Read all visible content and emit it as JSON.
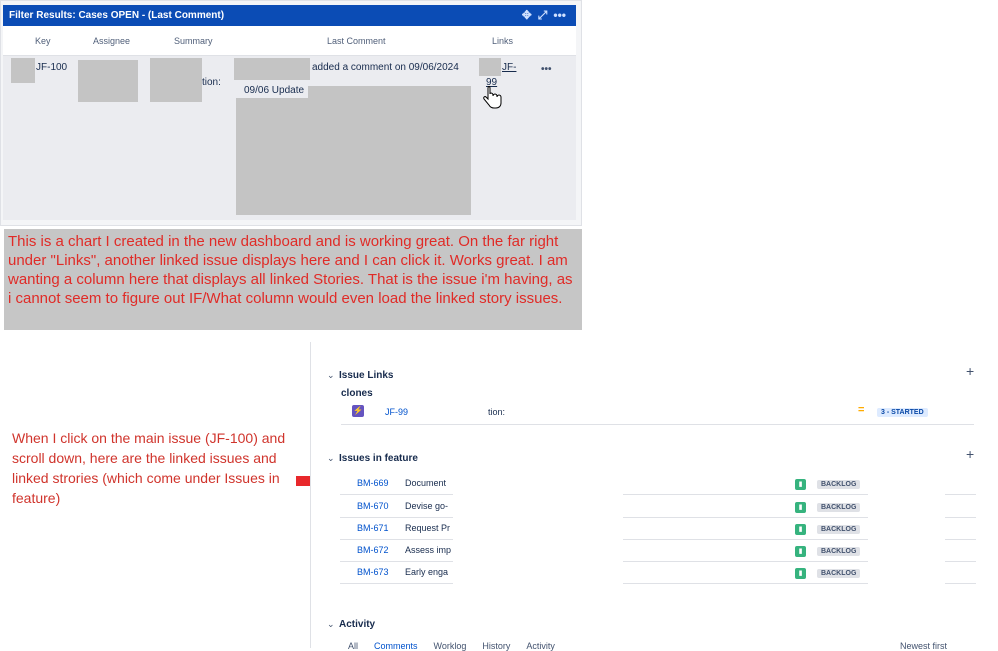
{
  "gadget": {
    "title": "Filter Results: Cases OPEN - (Last Comment)",
    "columns": [
      "Key",
      "Assignee",
      "Summary",
      "Last Comment",
      "Links"
    ],
    "row": {
      "key": "JF-100",
      "summary_fragment": "tion:",
      "comment_line1": "added a comment on 09/06/2024",
      "comment_line2": "09/06 Update",
      "link_key_a": "JF-",
      "link_key_b": "99",
      "more": "•••"
    },
    "header_icons": [
      "move-icon",
      "expand-icon",
      "more-icon"
    ]
  },
  "annotation": "This is a chart I created in the new dashboard and is working great. On the far right under \"Links\", another linked issue displays here and I can click it. Works great. I am wanting a column here that displays all linked Stories. That is the issue i'm having, as i cannot seem to figure out IF/What column would even load the linked story issues.",
  "left_note": "When I click on the main issue (JF-100) and scroll down, here are the linked issues and linked strories (which come under Issues in feature)",
  "issue_panel": {
    "issue_links_title": "Issue Links",
    "link_type": "clones",
    "linked_key": "JF-99",
    "linked_summary": "tion:",
    "linked_status": "3 - STARTED",
    "issues_in_feature_title": "Issues in feature",
    "feature_issues": [
      {
        "key": "BM-669",
        "summary": "Document",
        "status": "BACKLOG"
      },
      {
        "key": "BM-670",
        "summary": "Devise go-",
        "status": "BACKLOG"
      },
      {
        "key": "BM-671",
        "summary": "Request Pr",
        "status": "BACKLOG"
      },
      {
        "key": "BM-672",
        "summary": "Assess imp",
        "status": "BACKLOG"
      },
      {
        "key": "BM-673",
        "summary": "Early enga",
        "status": "BACKLOG"
      }
    ],
    "activity_title": "Activity",
    "activity_tabs": [
      "All",
      "Comments",
      "Worklog",
      "History",
      "Activity"
    ],
    "sort_label": "Newest first"
  },
  "colors": {
    "header": "#0b4cb5",
    "note_text": "#e02b27",
    "arrow": "#e8282b",
    "story": "#36b37e",
    "feature": "#6554c0"
  }
}
